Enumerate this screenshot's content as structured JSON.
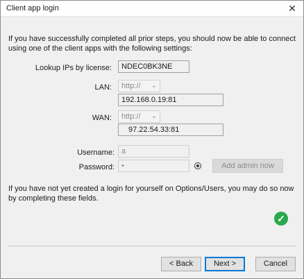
{
  "window": {
    "title": "Client app login"
  },
  "intro_text": "If you have successfully completed all prior steps, you should now be able to connect using one of the client apps with the following settings:",
  "lookup": {
    "label": "Lookup IPs by license:",
    "value": "NDEC0BK3NE"
  },
  "lan": {
    "label": "LAN:",
    "protocol": "http://",
    "address": "192.168.0.19:81"
  },
  "wan": {
    "label": "WAN:",
    "protocol": "http://",
    "address": "97.22.54.33:81"
  },
  "username": {
    "label": "Username:",
    "value": "a"
  },
  "password": {
    "label": "Password:",
    "value": "•"
  },
  "admin_button": "Add admin now",
  "note_text": "If you have not yet created a login for yourself on Options/Users, you may do so now by completing these fields.",
  "buttons": {
    "back": "< Back",
    "next": "Next >",
    "cancel": "Cancel"
  },
  "icons": {
    "close": "close-icon",
    "chevron": "chevron-down-icon",
    "eye": "eye-icon",
    "check": "check-icon"
  },
  "colors": {
    "success": "#2aa84a",
    "focus": "#0078d7"
  }
}
